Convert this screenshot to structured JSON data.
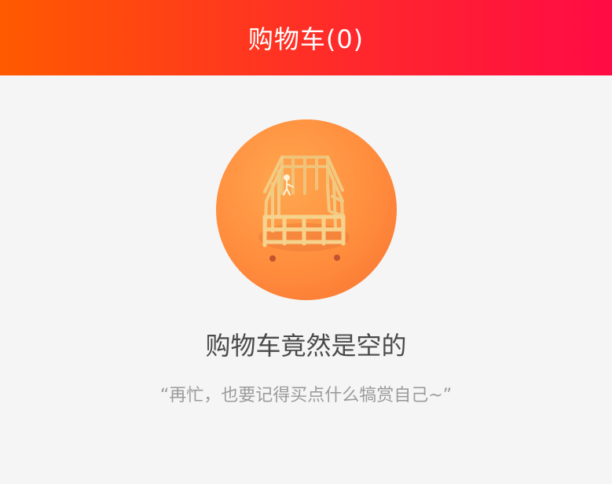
{
  "header": {
    "title": "购物车(0)"
  },
  "empty_state": {
    "illustration_icon": "empty-cart-illustration",
    "title": "购物车竟然是空的",
    "subtitle": "“再忙，也要记得买点什么犒赏自己~”"
  },
  "colors": {
    "header_gradient_start": "#ff5a00",
    "header_gradient_end": "#ff0b45",
    "background": "#f5f5f5",
    "illustration_orange": "#ff8d3e",
    "title_text": "#4a4a4a",
    "subtitle_text": "#9b9b9b"
  }
}
